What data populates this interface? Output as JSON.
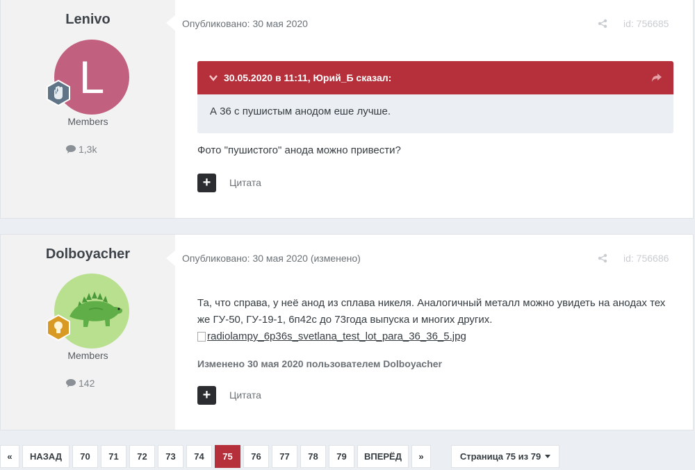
{
  "posts": [
    {
      "author": "Lenivo",
      "avatar_letter": "L",
      "avatar_color": "#c2607f",
      "group": "Members",
      "post_count": "1,3k",
      "meta": "Опубликовано: 30 мая 2020",
      "post_id": "id: 756685",
      "quote_header": "30.05.2020 в 11:11, Юрий_Б сказал:",
      "quote_text": "А 36 с пушистым анодом еше лучше.",
      "text": "Фото \"пушистого\" анода можно привести?",
      "quote_button": "Цитата"
    },
    {
      "author": "Dolboyacher",
      "group": "Members",
      "post_count": "142",
      "meta": "Опубликовано: 30 мая 2020 (изменено)",
      "post_id": "id: 756686",
      "text_line1": "Та, что справа, у неё анод из сплава никеля. Аналогичный металл можно увидеть на анодах тех",
      "text_line2": "же ГУ-50, ГУ-19-1, 6п42с до 73года выпуска и многих других.",
      "image_alt": "radiolampy_6p36s_svetlana_test_lot_para_36_36_5.jpg",
      "edited": "Изменено 30 мая 2020 пользователем Dolboyacher",
      "quote_button": "Цитата"
    }
  ],
  "pagination": {
    "first": "«",
    "prev": "НАЗАД",
    "pages": [
      "70",
      "71",
      "72",
      "73",
      "74",
      "75",
      "76",
      "77",
      "78",
      "79"
    ],
    "active_page": "75",
    "next": "ВПЕРЁД",
    "last": "»",
    "page_select": "Страница 75 из 79"
  },
  "colors": {
    "accent": "#b5303b",
    "author_bg": "#f2f2f2",
    "page_bg": "#ebeef2"
  }
}
